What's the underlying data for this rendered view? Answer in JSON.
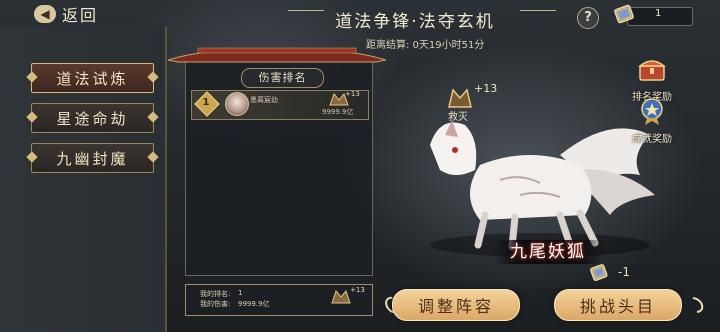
{
  "header": {
    "back_label": "返回",
    "title": "道法争锋·法夺玄机",
    "countdown": "距离结算: 0天19小时51分",
    "help_label": "?",
    "ticket_count": "1"
  },
  "nav": {
    "items": [
      {
        "label": "道法试炼",
        "active": true
      },
      {
        "label": "星途命劫",
        "active": false
      },
      {
        "label": "九幽封魔",
        "active": false
      }
    ]
  },
  "rank": {
    "title": "伤害排名",
    "entries": [
      {
        "rank": "1",
        "name": "墨离宸幼",
        "boss_plus": "+13",
        "damage": "9999.9亿"
      }
    ],
    "my_rank_label": "我的排名:",
    "my_rank_value": "1",
    "my_damage_label": "我的伤害:",
    "my_damage_value": "9999.9亿",
    "my_boss_plus": "+13"
  },
  "boss": {
    "name": "九尾妖狐",
    "level_plus": "+13",
    "tag": "救灭"
  },
  "rewards": [
    {
      "label": "排名奖励",
      "icon": "treasure-chest-icon"
    },
    {
      "label": "成就奖励",
      "icon": "achievement-badge-icon"
    }
  ],
  "cost": {
    "value": "-1",
    "icon": "challenge-ticket-icon"
  },
  "actions": {
    "adjust_label": "调整阵容",
    "challenge_label": "挑战头目"
  },
  "colors": {
    "accent_gold": "#d9b777",
    "button": "#e9bd7d",
    "panel": "#1c2024"
  }
}
